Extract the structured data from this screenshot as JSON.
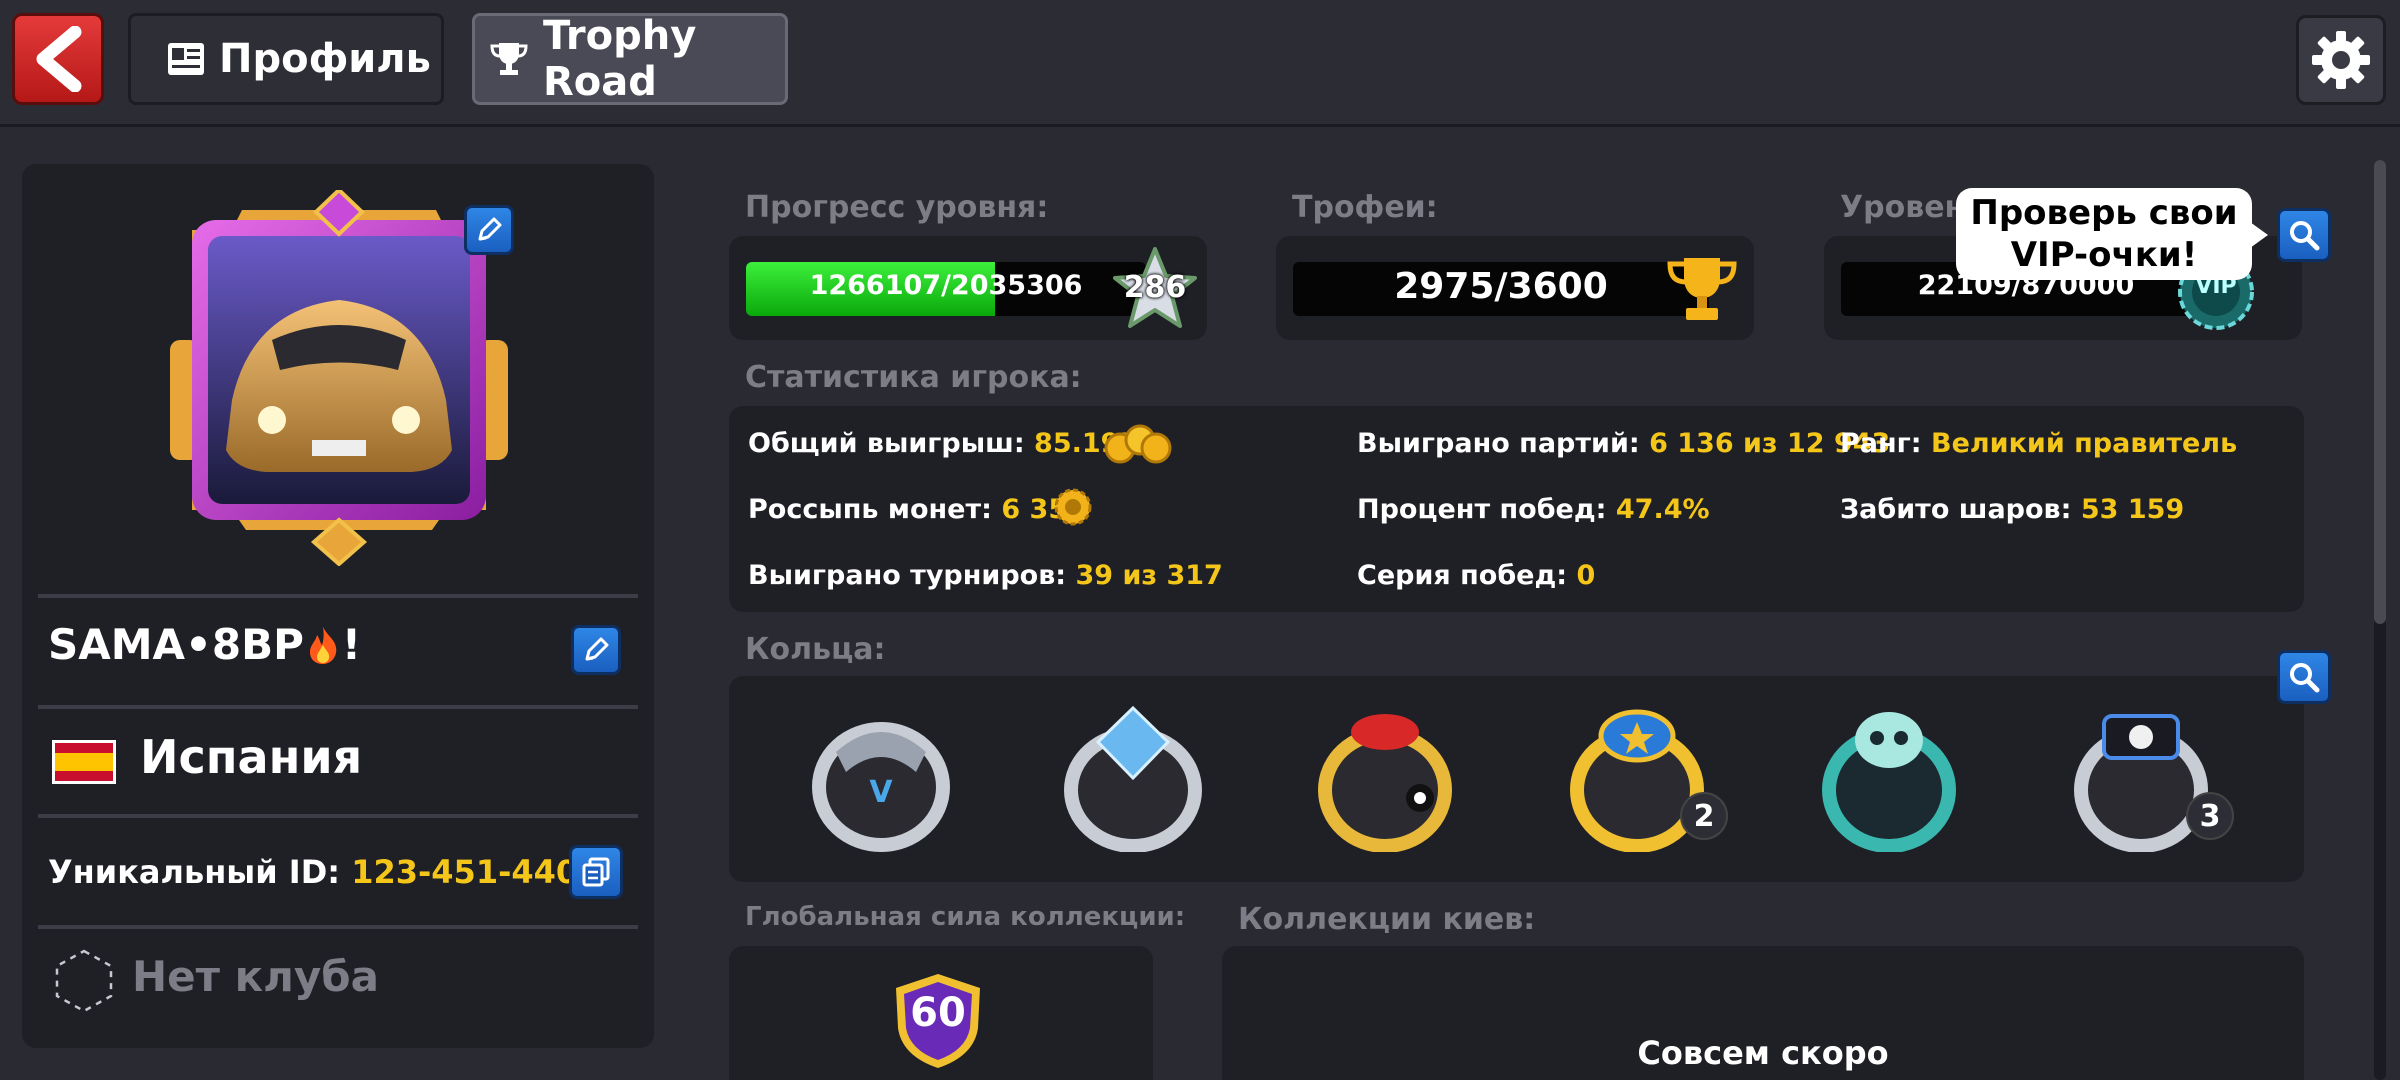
{
  "header": {
    "tab_profile": "Профиль",
    "tab_trophy": "Trophy Road"
  },
  "profile": {
    "name": "SAMA•8BP",
    "name_suffix": "!",
    "country": "Испания",
    "uid_label": "Уникальный ID:",
    "uid_value": "123-451-440-1",
    "club": "Нет клуба"
  },
  "level": {
    "label": "Прогресс уровня:",
    "progress_text": "1266107/2035306",
    "progress_fraction": 0.622,
    "level_number": "286"
  },
  "trophies": {
    "label": "Трофеи:",
    "value": "2975/3600"
  },
  "vip": {
    "label": "Уровень VIP:",
    "value": "22109/870000",
    "badge": "VIP",
    "tooltip_line1": "Проверь свои",
    "tooltip_line2": "VIP-очки!"
  },
  "stats": {
    "title": "Статистика игрока:",
    "total_win_label": "Общий выигрыш:",
    "total_win_value": "85.19B",
    "coin_drop_label": "Россыпь монет:",
    "coin_drop_value": "6 353",
    "tournaments_label": "Выиграно турниров:",
    "tournaments_value": "39 из 317",
    "games_won_label": "Выиграно партий:",
    "games_won_value": "6 136 из 12 943",
    "win_percent_label": "Процент побед:",
    "win_percent_value": "47.4%",
    "win_streak_label": "Серия побед:",
    "win_streak_value": "0",
    "rank_label": "Ранг:",
    "rank_value": "Великий правитель",
    "balls_label": "Забито шаров:",
    "balls_value": "53 159"
  },
  "rings": {
    "title": "Кольца:",
    "items": [
      {
        "name": "winstreak-ring",
        "count": ""
      },
      {
        "name": "diamond-ring",
        "count": ""
      },
      {
        "name": "legend-8ball-ring",
        "count": ""
      },
      {
        "name": "legend-gold-ring",
        "count": "2"
      },
      {
        "name": "skull-ring",
        "count": ""
      },
      {
        "name": "master-ring",
        "count": "3"
      }
    ]
  },
  "collection": {
    "power_title": "Глобальная сила коллекции:",
    "power_value": "60",
    "cues_title": "Коллекции киев:",
    "cues_status": "Совсем скоро"
  },
  "colors": {
    "accent_yellow": "#f5c61a",
    "progress_green": "#18d018",
    "edit_blue": "#2f86e6",
    "back_red": "#e53a3a"
  }
}
